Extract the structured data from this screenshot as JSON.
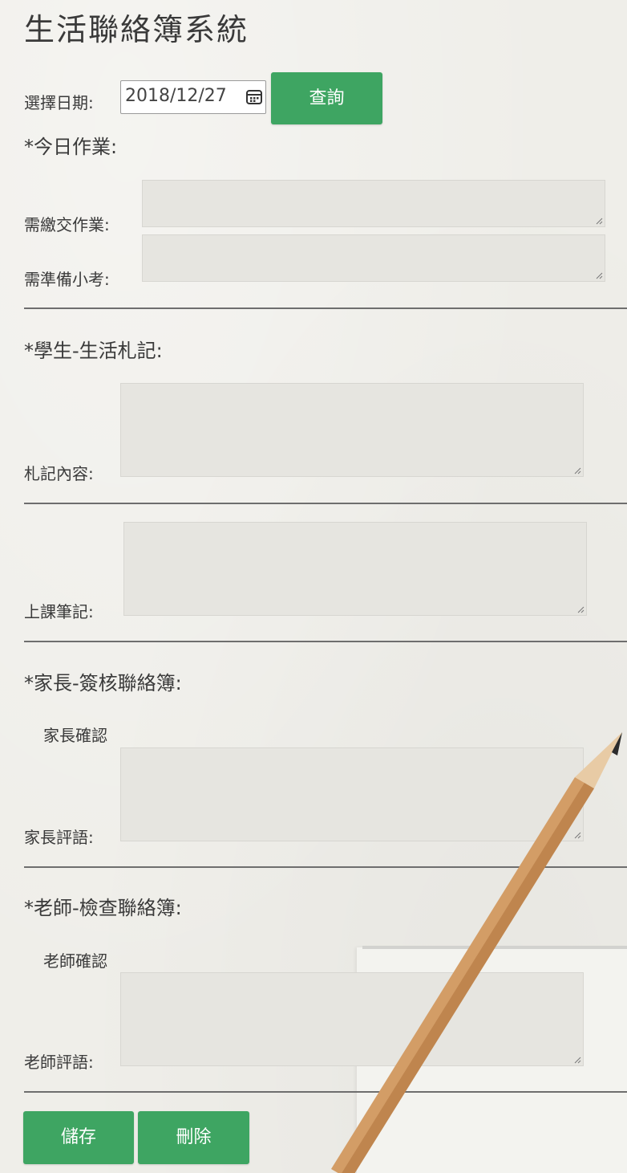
{
  "app": {
    "title": "生活聯絡簿系統"
  },
  "date_picker": {
    "label": "選擇日期:",
    "value": "2018/12/27",
    "icon": "calendar-icon"
  },
  "query_button": {
    "label": "查詢"
  },
  "homework": {
    "section_title": "*今日作業:",
    "submit_label": "需繳交作業:",
    "submit_value": "",
    "quiz_label": "需準備小考:",
    "quiz_value": ""
  },
  "student": {
    "section_title": "*學生-生活札記:",
    "journal_label": "札記內容:",
    "journal_value": "",
    "notes_label": "上課筆記:",
    "notes_value": ""
  },
  "parent": {
    "section_title": "*家長-簽核聯絡簿:",
    "confirm_label": "家長確認",
    "comment_label": "家長評語:",
    "comment_value": ""
  },
  "teacher": {
    "section_title": "*老師-檢查聯絡簿:",
    "confirm_label": "老師確認",
    "comment_label": "老師評語:",
    "comment_value": ""
  },
  "actions": {
    "save_label": "儲存",
    "delete_label": "刪除"
  },
  "colors": {
    "accent": "#3ea562",
    "background": "#efeee9",
    "textarea": "#e6e5e0",
    "rule": "#6e6e6e",
    "pencil": "#d29a62"
  }
}
